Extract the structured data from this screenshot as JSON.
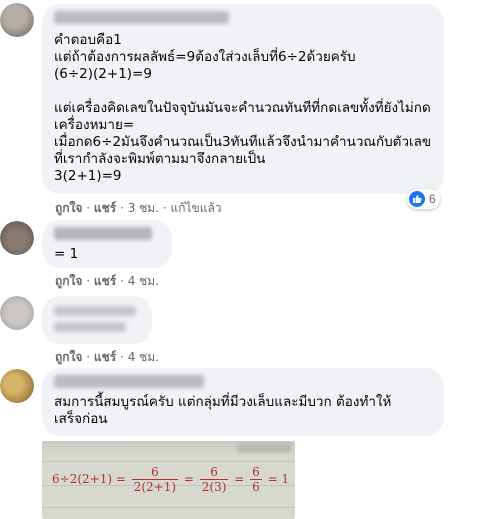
{
  "comments": [
    {
      "text": "คำตอบคือ1\nแต่ถ้าต้องการผลลัพธ์=9ต้องใส่วงเล็บที่6÷2ด้วยครับ\n(6÷2)(2+1)=9\n\nแต่เครื่องคิดเลขในปัจจุบันมันจะคำนวณทันทีที่กดเลขทั้งที่ยังไม่กดเครื่องหมาย=\nเมื่อกด6÷2มันจึงคำนวณเป็น3ทันทีแล้วจึงนำมาคำนวณกับตัวเลขที่เรากำลังจะพิมพ์ตามมาจึงกลายเป็น\n3(2+1)=9",
      "like": "ถูกใจ",
      "reply": "แชร์",
      "time": "3 ชม.",
      "edited": "แก้ไขแล้ว",
      "reaction_count": "6"
    },
    {
      "text": "= 1",
      "like": "ถูกใจ",
      "reply": "แชร์",
      "time": "4 ชม."
    },
    {
      "text": "",
      "like": "ถูกใจ",
      "reply": "แชร์",
      "time": "4 ชม."
    },
    {
      "text": "สมการนี้สมบูรณ์ครับ แต่กลุ่มที่มีวงเล็บและมีบวก ต้องทำให้\nเสร็จก่อน"
    }
  ],
  "photo": {
    "t1": "6÷2(2+1) =",
    "f1_num": "6",
    "f1_den": "2(2+1)",
    "t2": "=",
    "f2_num": "6",
    "f2_den": "2(3)",
    "t3": "=",
    "f3_num": "6",
    "f3_den": "6",
    "t4": "= 1"
  },
  "colors": {
    "bubble": "#f0f2f5",
    "secondary_text": "#65676b",
    "like_blue": "#1877f2"
  },
  "icons": [
    "like-icon"
  ]
}
